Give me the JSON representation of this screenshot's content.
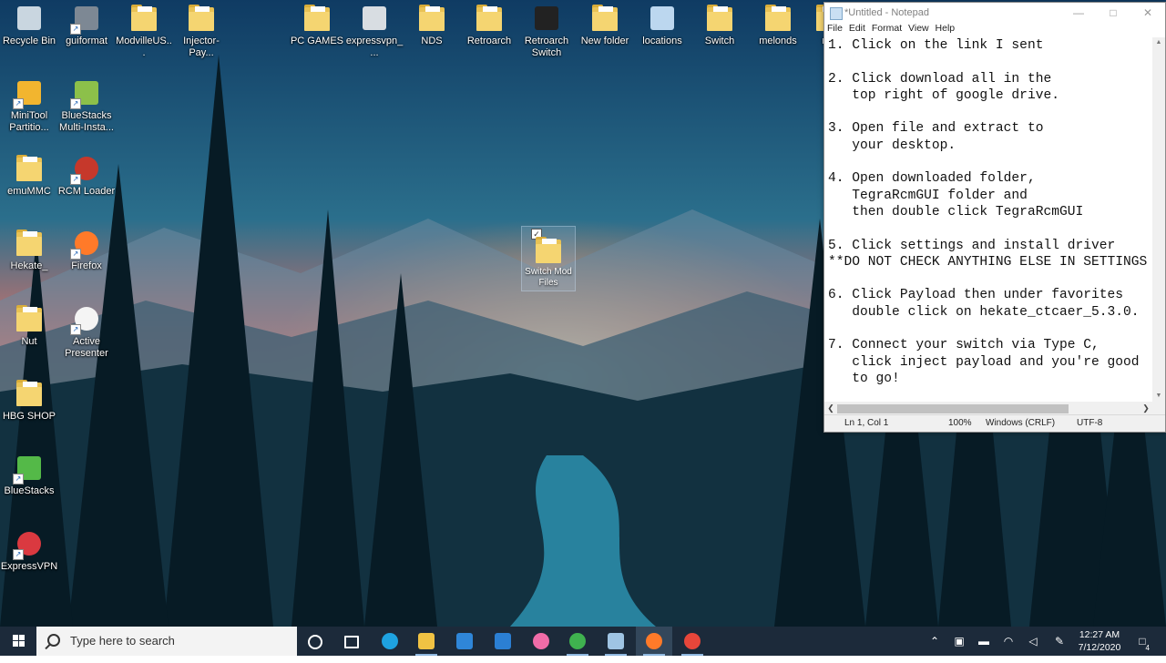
{
  "desktop": {
    "icons": [
      {
        "label": "Recycle Bin",
        "icon": "recycle-bin-icon"
      },
      {
        "label": "guiformat",
        "icon": "app-icon"
      },
      {
        "label": "ModvilleUS...",
        "icon": "folder-icon"
      },
      {
        "label": "Injector-Pay...",
        "icon": "folder-icon"
      },
      {
        "label": "PC GAMES",
        "icon": "folder-icon"
      },
      {
        "label": "expressvpn_...",
        "icon": "installer-icon"
      },
      {
        "label": "NDS",
        "icon": "folder-icon"
      },
      {
        "label": "Retroarch",
        "icon": "folder-icon"
      },
      {
        "label": "Retroarch Switch",
        "icon": "retroarch-icon"
      },
      {
        "label": "New folder",
        "icon": "folder-icon"
      },
      {
        "label": "locations",
        "icon": "notepad-file-icon"
      },
      {
        "label": "Switch",
        "icon": "folder-icon"
      },
      {
        "label": "melonds",
        "icon": "folder-icon"
      },
      {
        "label": "me",
        "icon": "folder-icon"
      },
      {
        "label": "MiniTool Partitio...",
        "icon": "minitool-icon"
      },
      {
        "label": "BlueStacks Multi-Insta...",
        "icon": "bluestacks-multi-icon"
      },
      {
        "label": "emuMMC",
        "icon": "folder-icon"
      },
      {
        "label": "RCM Loader",
        "icon": "rcm-loader-icon"
      },
      {
        "label": "Hekate_",
        "icon": "folder-icon"
      },
      {
        "label": "Firefox",
        "icon": "firefox-icon"
      },
      {
        "label": "Nut",
        "icon": "folder-icon"
      },
      {
        "label": "Active Presenter",
        "icon": "active-presenter-icon"
      },
      {
        "label": "HBG SHOP",
        "icon": "folder-icon"
      },
      {
        "label": "BlueStacks",
        "icon": "bluestacks-icon"
      },
      {
        "label": "ExpressVPN",
        "icon": "expressvpn-icon"
      }
    ],
    "selected_folder": {
      "label": "Switch Mod Files",
      "icon": "folder-icon"
    }
  },
  "notepad": {
    "title": "*Untitled - Notepad",
    "menu": [
      "File",
      "Edit",
      "Format",
      "View",
      "Help"
    ],
    "lines": [
      "1. Click on the link I sent",
      "",
      "2. Click download all in the",
      "   top right of google drive.",
      "",
      "3. Open file and extract to",
      "   your desktop.",
      "",
      "4. Open downloaded folder,",
      "   TegraRcmGUI folder and",
      "   then double click TegraRcmGUI",
      "",
      "5. Click settings and install driver",
      "**DO NOT CHECK ANYTHING ELSE IN SETTINGS",
      "",
      "6. Click Payload then under favorites",
      "   double click on hekate_ctcaer_5.3.0.",
      "",
      "7. Connect your switch via Type C,",
      "   click inject payload and you're good",
      "   to go!"
    ],
    "status": {
      "position": "Ln 1, Col 1",
      "zoom": "100%",
      "line_ending": "Windows (CRLF)",
      "encoding": "UTF-8"
    },
    "hscroll_position": 0
  },
  "taskbar": {
    "search_placeholder": "Type here to search",
    "apps": [
      {
        "name": "cortana",
        "icon": "cortana-icon",
        "color": "#ffffff"
      },
      {
        "name": "task-view",
        "icon": "task-view-icon",
        "color": "#ffffff"
      },
      {
        "name": "edge",
        "icon": "edge-icon",
        "color": "#1ea2e0"
      },
      {
        "name": "file-explorer",
        "icon": "folder-icon",
        "color": "#f0c243"
      },
      {
        "name": "store",
        "icon": "store-icon",
        "color": "#2f86d8"
      },
      {
        "name": "mail",
        "icon": "mail-icon",
        "color": "#2b7fd3"
      },
      {
        "name": "itunes",
        "icon": "itunes-icon",
        "color": "#f06ca8"
      },
      {
        "name": "vpn",
        "icon": "vpn-icon",
        "color": "#3fb24f"
      },
      {
        "name": "notepad",
        "icon": "notepad-icon",
        "color": "#9fc4e3"
      },
      {
        "name": "firefox",
        "icon": "firefox-icon",
        "color": "#ff7a29"
      },
      {
        "name": "active-presenter",
        "icon": "active-presenter-icon",
        "color": "#e7463a"
      }
    ],
    "tray_icons": [
      "chevron-up-icon",
      "security-icon",
      "usb-icon",
      "wifi-icon",
      "volume-icon",
      "pen-icon"
    ],
    "clock": {
      "time": "12:27 AM",
      "date": "7/12/2020"
    },
    "notifications_count": "4"
  }
}
